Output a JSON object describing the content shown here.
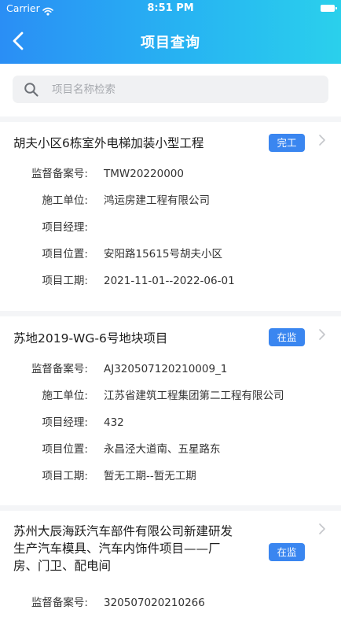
{
  "status_bar": {
    "carrier": "Carrier",
    "time": "8:51 PM"
  },
  "header": {
    "title": "项目查询"
  },
  "search": {
    "placeholder": "项目名称检索"
  },
  "projects": [
    {
      "title": "胡夫小区6栋室外电梯加装小型工程",
      "status": "完工",
      "fields": [
        {
          "label": "监督备案号:",
          "value": "TMW20220000"
        },
        {
          "label": "施工单位:",
          "value": "鸿运房建工程有限公司"
        },
        {
          "label": "项目经理:",
          "value": ""
        },
        {
          "label": "项目位置:",
          "value": "安阳路15615号胡夫小区"
        },
        {
          "label": "项目工期:",
          "value": "2021-11-01--2022-06-01"
        }
      ]
    },
    {
      "title": "苏地2019-WG-6号地块项目",
      "status": "在监",
      "fields": [
        {
          "label": "监督备案号:",
          "value": "AJ320507120210009_1"
        },
        {
          "label": "施工单位:",
          "value": "江苏省建筑工程集团第二工程有限公司"
        },
        {
          "label": "项目经理:",
          "value": "432"
        },
        {
          "label": "项目位置:",
          "value": "永昌泾大道南、五星路东"
        },
        {
          "label": "项目工期:",
          "value": "暂无工期--暂无工期"
        }
      ]
    },
    {
      "title_lines": [
        "苏州大辰海跃汽车部件有限公司新建研发",
        "生产汽车模具、汽车内饰件项目——厂",
        "房、门卫、配电间"
      ],
      "status": "在监",
      "fields": [
        {
          "label": "监督备案号:",
          "value": "320507020210266"
        }
      ]
    }
  ],
  "icons": {
    "back": "chevron-left-icon",
    "search": "search-icon",
    "row_arrow": "chevron-right-icon",
    "wifi": "wifi-icon",
    "battery": "battery-icon"
  },
  "colors": {
    "header_start": "#2a8ef5",
    "header_end": "#2ad0ec",
    "badge": "#3a86f0"
  }
}
